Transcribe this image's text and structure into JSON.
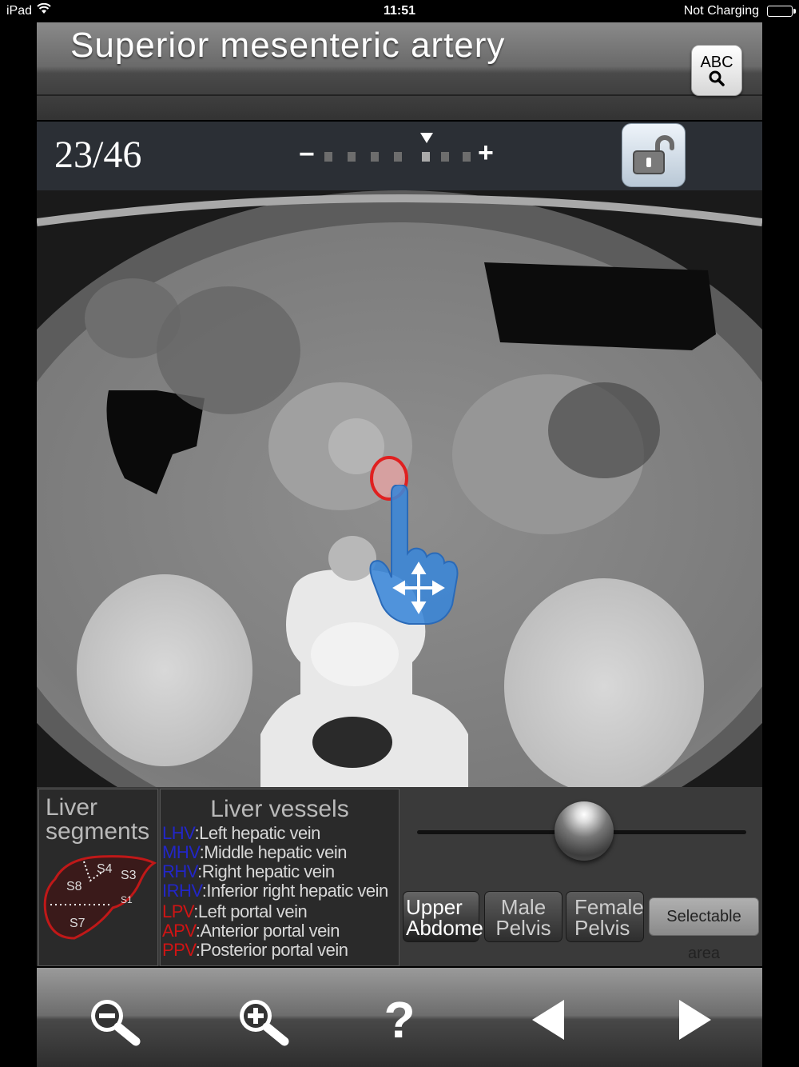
{
  "status_bar": {
    "device": "iPad",
    "time": "11:51",
    "charging": "Not Charging"
  },
  "header": {
    "title": "Superior mesenteric artery",
    "abc_label": "ABC"
  },
  "slice": {
    "counter": "23/46",
    "current": 23,
    "total": 46,
    "minus_label": "−",
    "plus_label": "+"
  },
  "liver_segments": {
    "title_line1": "Liver",
    "title_line2": "segments",
    "labels": [
      "S8",
      "S4",
      "S3",
      "S1",
      "S7"
    ]
  },
  "liver_vessels": {
    "title": "Liver vessels",
    "items": [
      {
        "abbr": "LHV",
        "text": "Left hepatic vein",
        "color": "#2226c8"
      },
      {
        "abbr": "MHV",
        "text": "Middle hepatic vein",
        "color": "#2226c8"
      },
      {
        "abbr": "RHV",
        "text": "Right hepatic vein",
        "color": "#2226c8"
      },
      {
        "abbr": "IRHV",
        "text": "Inferior right hepatic vein",
        "color": "#2226c8"
      },
      {
        "abbr": "LPV",
        "text": "Left portal vein",
        "color": "#d01414"
      },
      {
        "abbr": "APV",
        "text": "Anterior portal vein",
        "color": "#d01414"
      },
      {
        "abbr": "PPV",
        "text": "Posterior portal vein",
        "color": "#d01414"
      }
    ]
  },
  "regions": [
    {
      "line1": "Upper",
      "line2": "Abdomen",
      "active": true
    },
    {
      "line1": "Male",
      "line2": "Pelvis",
      "active": false
    },
    {
      "line1": "Female",
      "line2": "Pelvis",
      "active": false
    }
  ],
  "selectable_label": "Selectable area",
  "slider": {
    "value": 0.5
  },
  "toolbar": {
    "icons": [
      "zoom-out-icon",
      "zoom-in-icon",
      "help-icon",
      "previous-icon",
      "next-icon"
    ],
    "help_label": "?"
  },
  "colors": {
    "highlight": "#e04040",
    "hand_cursor": "#3a86d8",
    "vein_blue": "#2226c8",
    "vein_red": "#d01414"
  }
}
